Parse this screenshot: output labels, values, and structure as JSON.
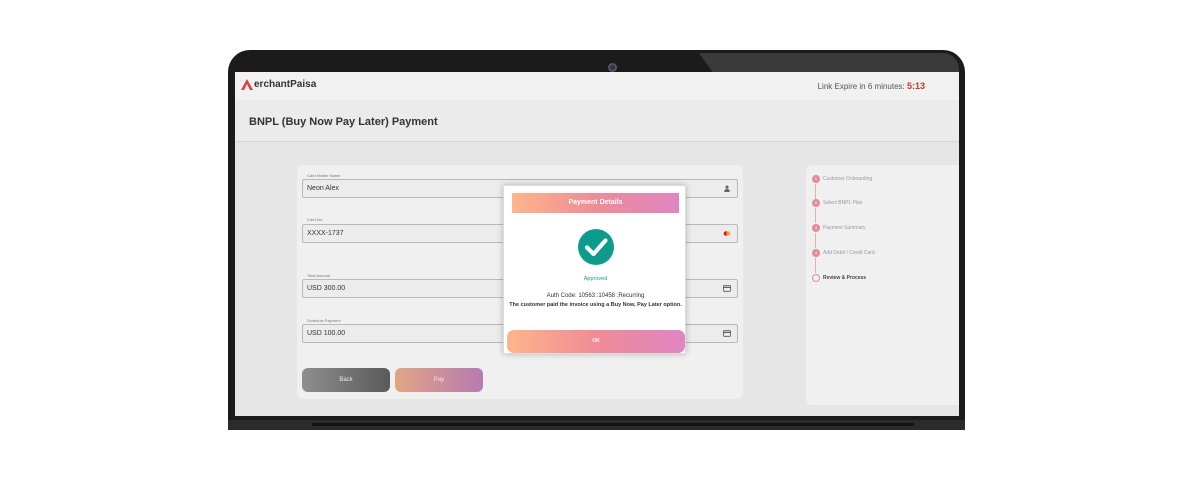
{
  "app": {
    "logo_text": "erchantPaisa",
    "logo_letter": "M",
    "expire_label": "Link Expire in 6 minutes: ",
    "expire_time": "5:13"
  },
  "page": {
    "title": "BNPL (Buy Now Pay Later) Payment"
  },
  "form": {
    "card_holder_label": "Card Holder Name",
    "card_holder_value": "Neon Alex",
    "card_no_label": "Card No.",
    "card_no_value": "XXXX-1737",
    "total_amount_label": "Total Amount",
    "total_amount_value": "USD 300.00",
    "schedule_label": "Schedule Payment",
    "schedule_value": "USD 100.00",
    "back_label": "Back",
    "pay_label": "Pay"
  },
  "steps": [
    {
      "num": "1",
      "label": "Customer Onboarding"
    },
    {
      "num": "2",
      "label": "Select BNPL Plan"
    },
    {
      "num": "3",
      "label": "Payment Summary"
    },
    {
      "num": "4",
      "label": "Add Debit / Credit Card"
    },
    {
      "num": "5",
      "label": "Review & Process"
    }
  ],
  "modal": {
    "title": "Payment Details",
    "status": "Approved",
    "auth_line": "Auth Code: 10563::10458 ;Recurring",
    "message": "The customer paid the invoice using a Buy Now, Pay Later option.",
    "ok_label": "OK"
  },
  "colors": {
    "accent_gradient_start": "#fdb58b",
    "accent_gradient_end": "#df85c4",
    "success": "#0b9c8e",
    "timer": "#d0342c"
  }
}
